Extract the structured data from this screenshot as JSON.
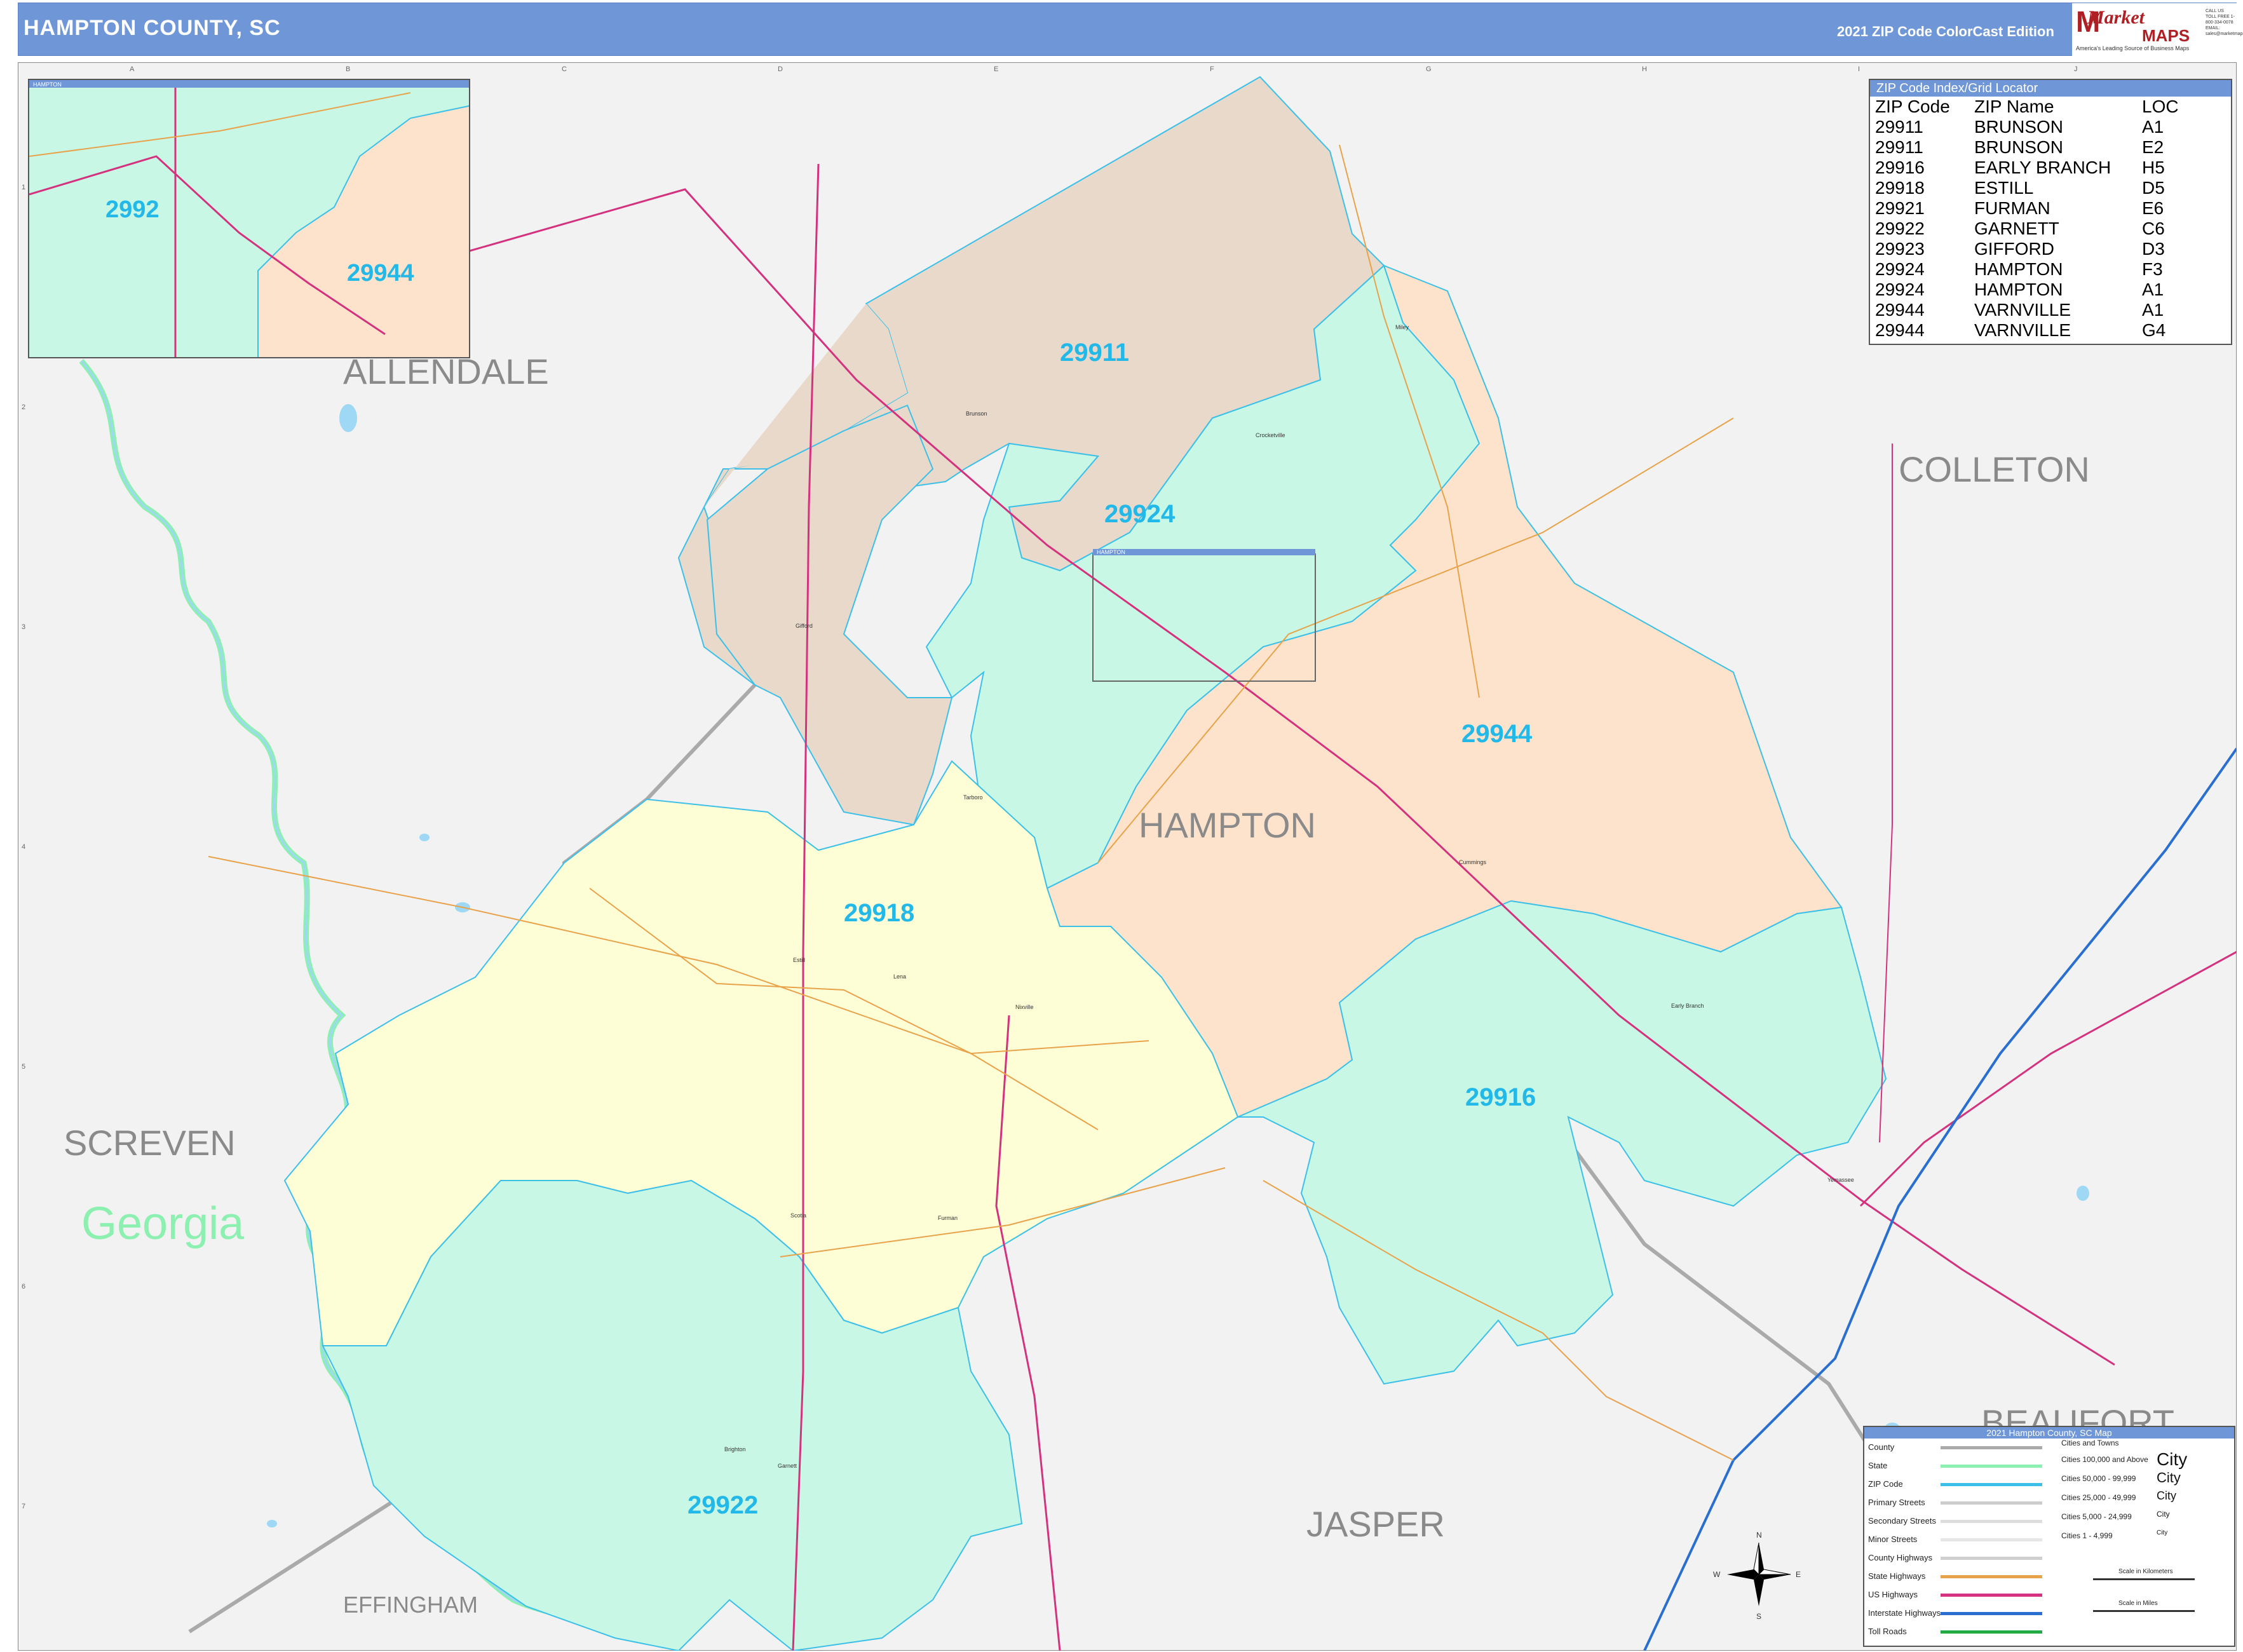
{
  "header": {
    "title": "HAMPTON COUNTY, SC",
    "edition": "2021 ZIP Code ColorCast Edition",
    "logo": {
      "brand": "Market",
      "maps": "MAPS",
      "slogan": "America's Leading Source of Business Maps",
      "contact": "CALL US TOLL FREE 1-800-334-0078 EMAIL: sales@marketmaps.com"
    }
  },
  "counties": {
    "allendale": "ALLENDALE",
    "colleton": "COLLETON",
    "hampton": "HAMPTON",
    "screven": "SCREVEN",
    "jasper": "JASPER",
    "effingham": "EFFINGHAM",
    "beaufort": "BEAUFORT"
  },
  "state_label": "Georgia",
  "zips": {
    "z29911": "29911",
    "z29924": "29924",
    "z29944": "29944",
    "z29918": "29918",
    "z29916": "29916",
    "z29922": "29922"
  },
  "inset": {
    "title": "HAMPTON",
    "zip_left": "2992",
    "zip_right": "29944"
  },
  "inset_box_label": "HAMPTON",
  "zip_index": {
    "title": "ZIP Code Index/Grid Locator",
    "headers": [
      "ZIP Code",
      "ZIP Name",
      "LOC"
    ],
    "rows": [
      [
        "29911",
        "BRUNSON",
        "A1"
      ],
      [
        "29911",
        "BRUNSON",
        "E2"
      ],
      [
        "29916",
        "EARLY BRANCH",
        "H5"
      ],
      [
        "29918",
        "ESTILL",
        "D5"
      ],
      [
        "29921",
        "FURMAN",
        "E6"
      ],
      [
        "29922",
        "GARNETT",
        "C6"
      ],
      [
        "29923",
        "GIFFORD",
        "D3"
      ],
      [
        "29924",
        "HAMPTON",
        "F3"
      ],
      [
        "29924",
        "HAMPTON",
        "A1"
      ],
      [
        "29944",
        "VARNVILLE",
        "A1"
      ],
      [
        "29944",
        "VARNVILLE",
        "G4"
      ]
    ]
  },
  "legend": {
    "title": "2021 Hampton County, SC Map",
    "items": [
      "County",
      "State",
      "ZIP Code",
      "Primary Streets",
      "Secondary Streets",
      "Minor Streets",
      "County Highways",
      "State Highways",
      "US Highways",
      "Interstate Highways",
      "Toll Roads"
    ],
    "cities_title": "Cities and Towns",
    "city_classes": [
      "Cities 100,000 and Above",
      "Cities 50,000 - 99,999",
      "Cities 25,000 - 49,999",
      "Cities 5,000 - 24,999",
      "Cities 1 - 4,999"
    ],
    "city_samples": [
      "City",
      "City",
      "City",
      "City",
      "City"
    ],
    "scale_km": "Scale in Kilometers",
    "scale_mi": "Scale in Miles"
  },
  "compass": {
    "n": "N",
    "s": "S",
    "e": "E",
    "w": "W"
  },
  "towns": {
    "brunson": "Brunson",
    "gifford": "Gifford",
    "estill": "Estill",
    "luray": "Luray",
    "scotia": "Scotia",
    "furman": "Furman",
    "garnett": "Garnett",
    "brighton": "Brighton",
    "crocketville": "Crocketville",
    "cummings": "Cummings",
    "early_branch": "Early Branch",
    "yemassee": "Yemassee",
    "miley": "Miley",
    "nixville": "Nixville",
    "tarboro": "Tarboro",
    "lena": "Lena"
  },
  "grid": {
    "cols": [
      "A",
      "B",
      "C",
      "D",
      "E",
      "F",
      "G",
      "H",
      "I",
      "J"
    ],
    "rows": [
      "1",
      "2",
      "3",
      "4",
      "5",
      "6",
      "7"
    ]
  },
  "colors": {
    "z29911": "#e8d9cb",
    "z29924": "#c9f7e5",
    "z29944": "#fde3cc",
    "z29918": "#fefed6",
    "z29916": "#c9f7e5",
    "z29922": "#c9f7e5",
    "header": "#6f97d8",
    "zip_border": "#3cc0e8",
    "us_hwy": "#d4327f",
    "state_hwy": "#e8a24a",
    "interstate": "#2a6fd0",
    "georgia": "#8cf0b0"
  }
}
